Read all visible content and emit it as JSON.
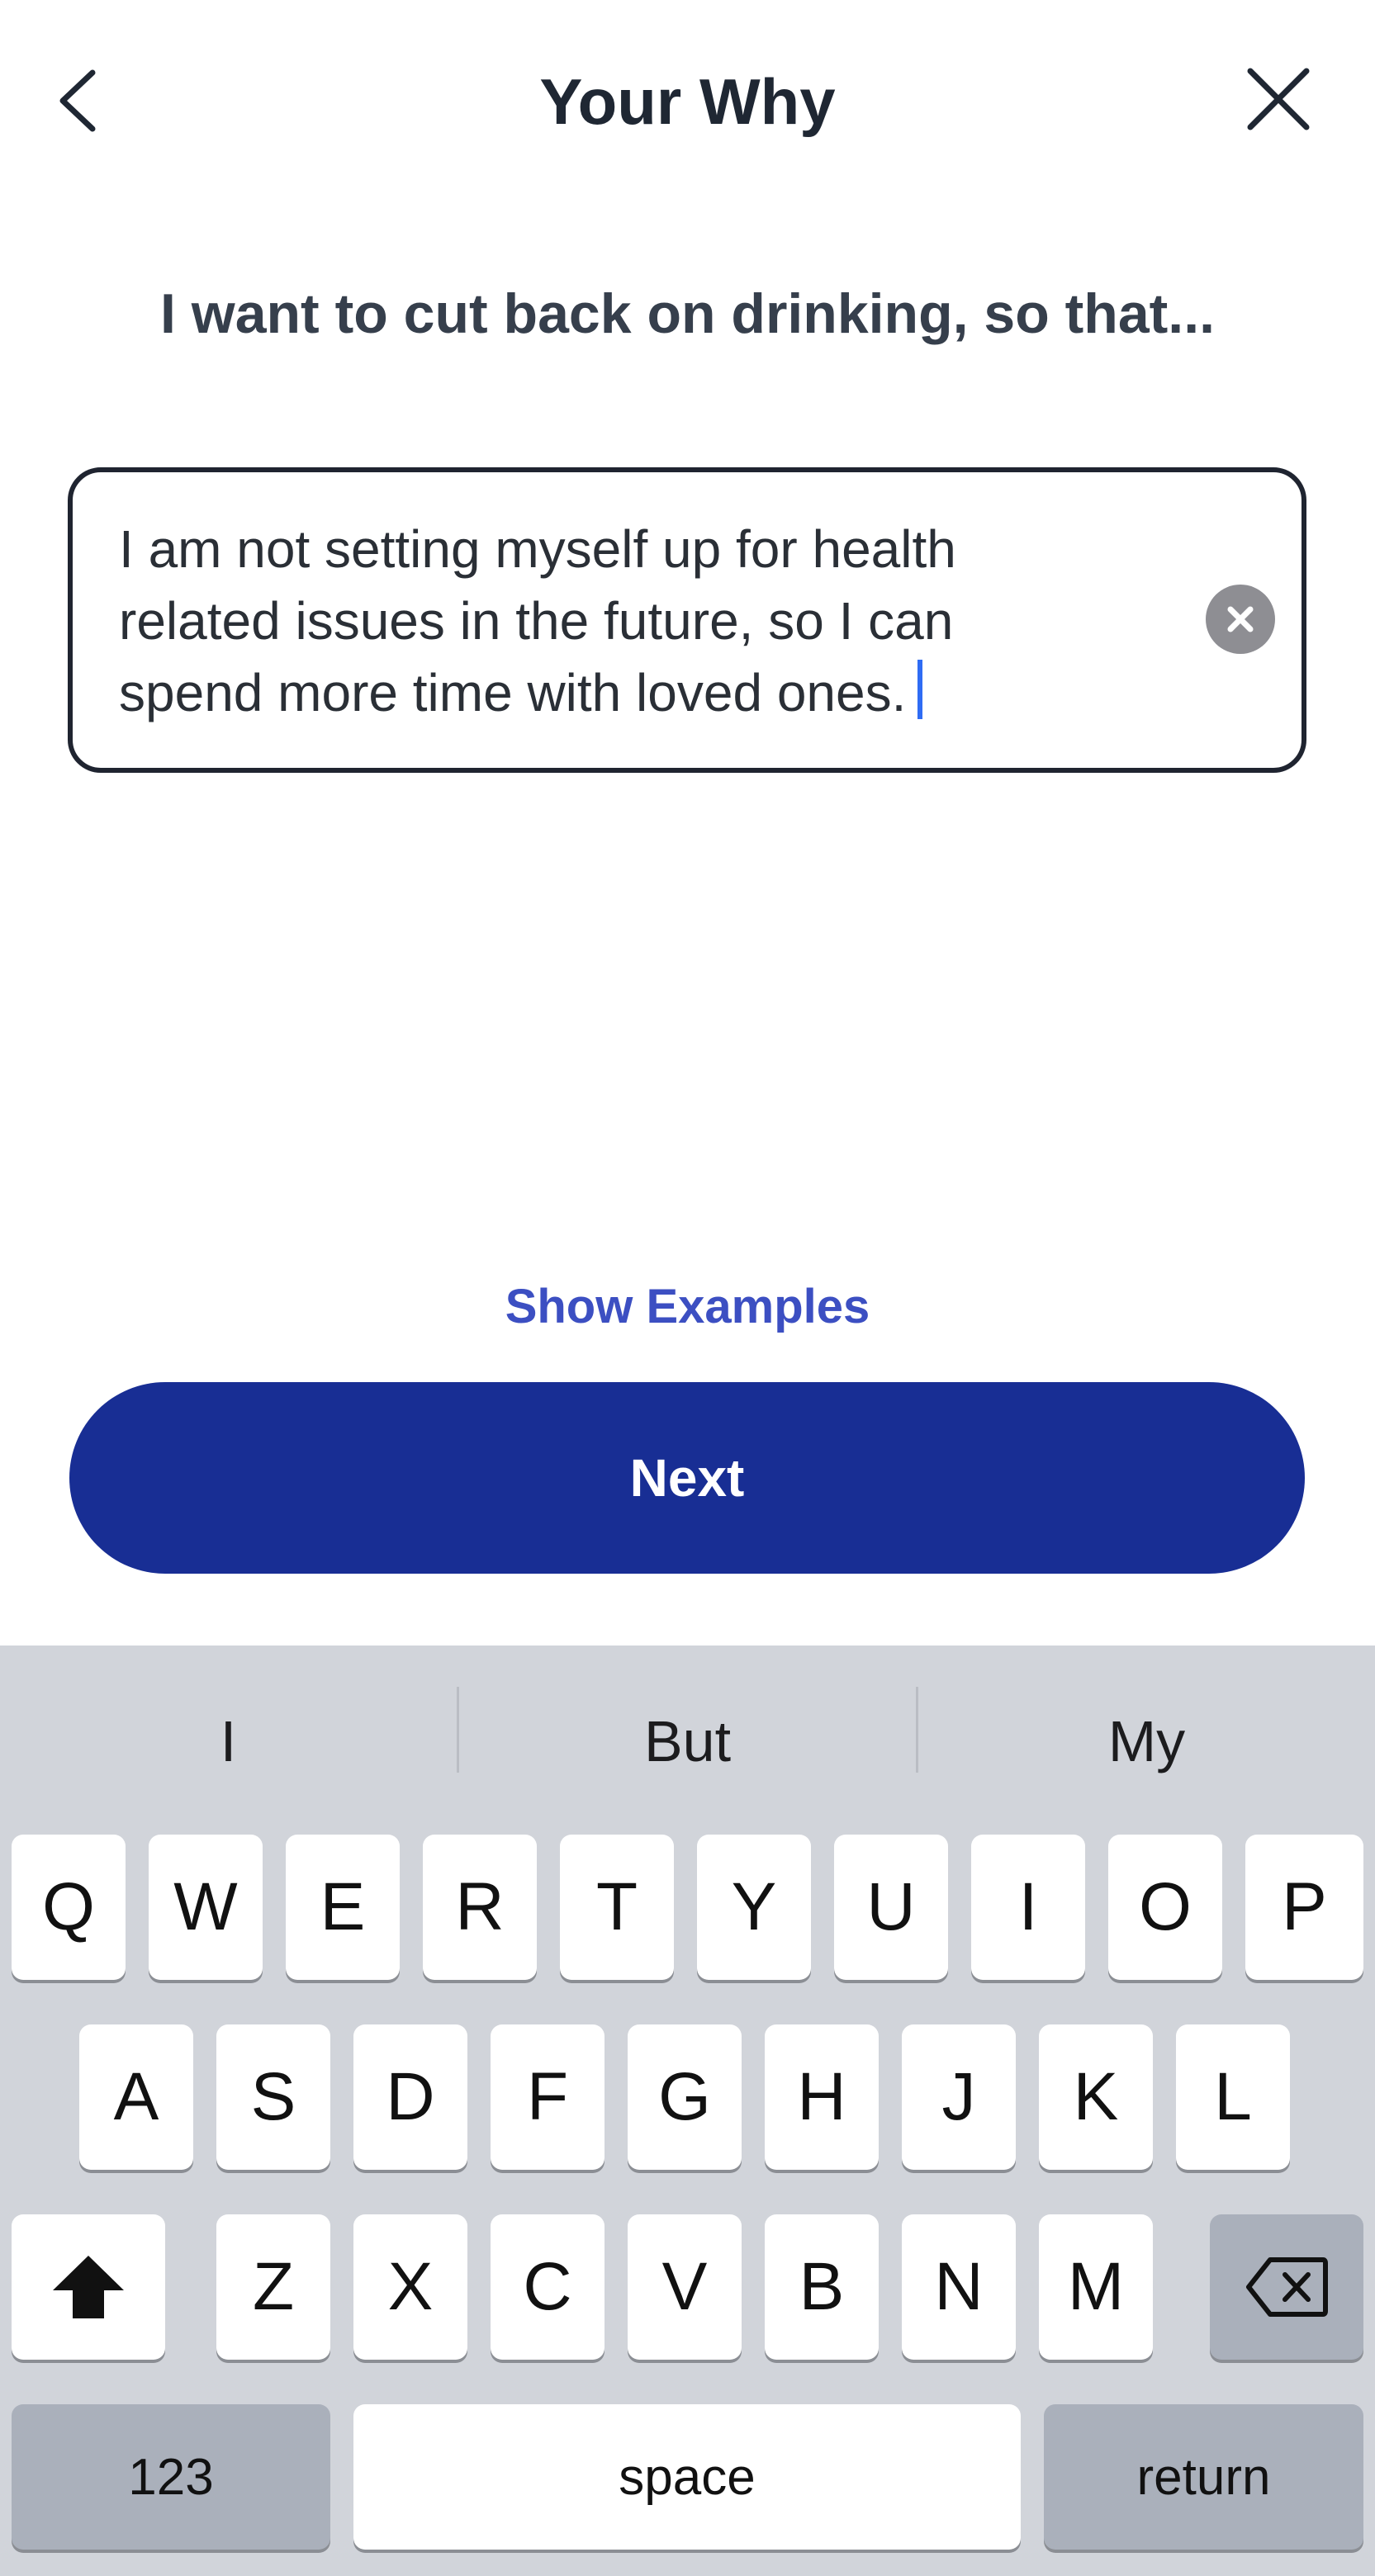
{
  "header": {
    "title": "Your Why",
    "back_icon": "chevron-left-icon",
    "close_icon": "close-icon"
  },
  "prompt": "I want to cut back on drinking, so that...",
  "answer_field": {
    "value_lines": [
      "I am not setting myself up for health",
      "related issues in the future, so I can",
      "spend more time with loved ones."
    ],
    "clear_icon": "clear-circle-icon",
    "caret_color": "#2f6cf4"
  },
  "show_examples_label": "Show Examples",
  "next_label": "Next",
  "colors": {
    "accent": "#3c4fc2",
    "button": "#182e94",
    "keyboard_bg": "#d1d4da"
  },
  "keyboard": {
    "suggestions": [
      "I",
      "But",
      "My"
    ],
    "row1": [
      "Q",
      "W",
      "E",
      "R",
      "T",
      "Y",
      "U",
      "I",
      "O",
      "P"
    ],
    "row2": [
      "A",
      "S",
      "D",
      "F",
      "G",
      "H",
      "J",
      "K",
      "L"
    ],
    "row3": [
      "Z",
      "X",
      "C",
      "V",
      "B",
      "N",
      "M"
    ],
    "shift_icon": "shift-arrow-icon",
    "delete_icon": "backspace-icon",
    "numbers_label": "123",
    "space_label": "space",
    "return_label": "return"
  }
}
